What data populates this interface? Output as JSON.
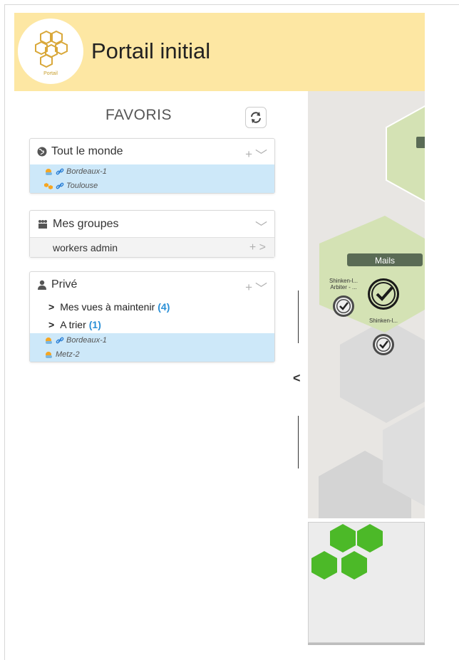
{
  "header": {
    "title": "Portail initial",
    "logo_label": "Portail",
    "background": "#fde7a3"
  },
  "favorites": {
    "title": "FAVORIS",
    "refresh_icon": "refresh-icon"
  },
  "panels": {
    "everyone": {
      "label": "Tout le monde",
      "icon": "globe-icon",
      "items": [
        {
          "label": "Bordeaux-1",
          "icon": "weather-icon",
          "link": true
        },
        {
          "label": "Toulouse",
          "icon": "tile-icon",
          "link": true
        }
      ]
    },
    "groups": {
      "label": "Mes groupes",
      "icon": "group-icon",
      "items": [
        {
          "label": "workers admin"
        }
      ]
    },
    "private": {
      "label": "Privé",
      "icon": "user-icon",
      "folders": [
        {
          "label": "Mes vues à maintenir",
          "count": "(4)"
        },
        {
          "label": "A trier",
          "count": "(1)"
        }
      ],
      "items": [
        {
          "label": "Bordeaux-1",
          "icon": "weather-icon",
          "link": true
        },
        {
          "label": "Metz-2",
          "icon": "weather-icon",
          "link": false
        }
      ]
    }
  },
  "map": {
    "group_label": "Mails",
    "nodes": [
      {
        "label_line1": "Shinken-l...",
        "label_line2": "Arbiter - ..."
      },
      {
        "label_line1": "Shinken-l..."
      }
    ],
    "colors": {
      "hex_green": "#d4e2b4",
      "hex_gray": "#dadada",
      "badge_dark": "#5a6b55",
      "mini_green": "#4cb928"
    }
  }
}
